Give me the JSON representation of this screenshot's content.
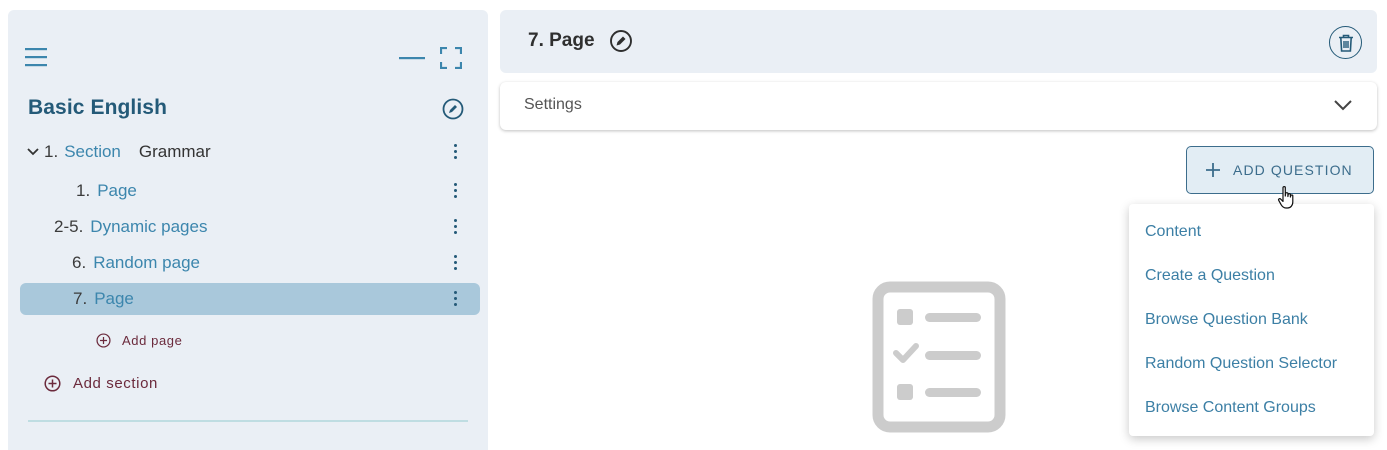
{
  "sidebar": {
    "course_title": "Basic English",
    "tree": [
      {
        "num": "1.",
        "link": "Section",
        "name": "Grammar"
      },
      {
        "num": "1.",
        "link": "Page"
      },
      {
        "num": "2-5.",
        "link": "Dynamic pages"
      },
      {
        "num": "6.",
        "link": "Random page"
      },
      {
        "num": "7.",
        "link": "Page"
      }
    ],
    "add_page_label": "Add page",
    "add_section_label": "Add section"
  },
  "page": {
    "title": "7. Page",
    "settings_label": "Settings"
  },
  "add_question": {
    "label": "ADD QUESTION",
    "menu": [
      "Content",
      "Create a Question",
      "Browse Question Bank",
      "Random Question Selector",
      "Browse Content Groups"
    ]
  },
  "colors": {
    "accent": "#245a78",
    "link": "#3c86ad",
    "selected_row": "#a9c8db",
    "panel_bg": "#eaeff5",
    "add_text": "#6b2a3c"
  },
  "icons": [
    "hamburger-icon",
    "minimize-icon",
    "fullscreen-icon",
    "pencil-icon",
    "chevron-down-icon",
    "kebab-icon",
    "plus-circle-icon",
    "trash-icon",
    "plus-icon",
    "hand-cursor-icon",
    "checklist-icon"
  ]
}
